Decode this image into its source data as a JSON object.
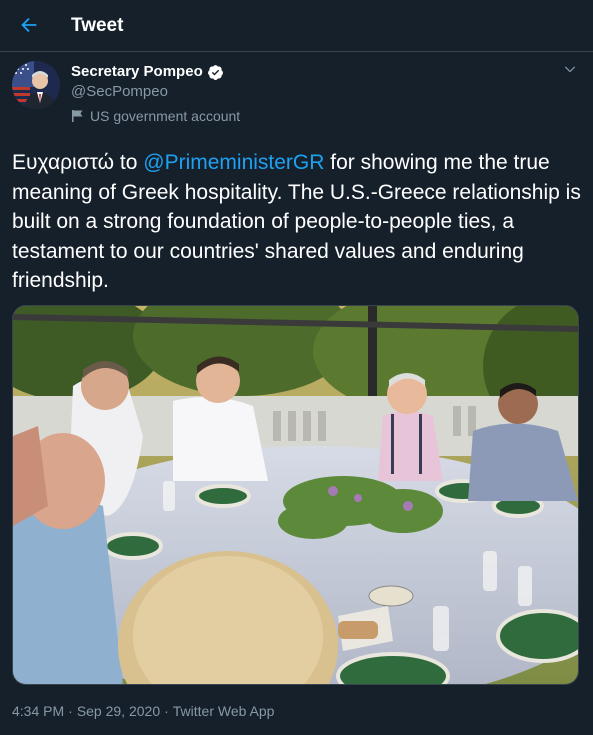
{
  "header": {
    "title": "Tweet"
  },
  "author": {
    "name": "Secretary Pompeo",
    "handle": "@SecPompeo",
    "gov_label": "US government account",
    "verified": true
  },
  "tweet": {
    "text_before": "Ευχαριστώ to ",
    "mention": "@PrimeministerGR",
    "text_after": " for showing me the true meaning of Greek hospitality. The U.S.-Greece relationship is built on a strong foundation of people-to-people ties, a testament to our countries' shared values and enduring friendship."
  },
  "meta": {
    "time": "4:34 PM",
    "date": "Sep 29, 2020",
    "source": "Twitter Web App",
    "separator": "·"
  },
  "colors": {
    "background": "#15202b",
    "accent": "#1da1f2",
    "secondary_text": "#8899a6",
    "border": "#38444d"
  },
  "icons": {
    "back": "arrow-left-icon",
    "verified": "verified-badge-icon",
    "government": "flag-icon",
    "more": "chevron-down-icon"
  }
}
